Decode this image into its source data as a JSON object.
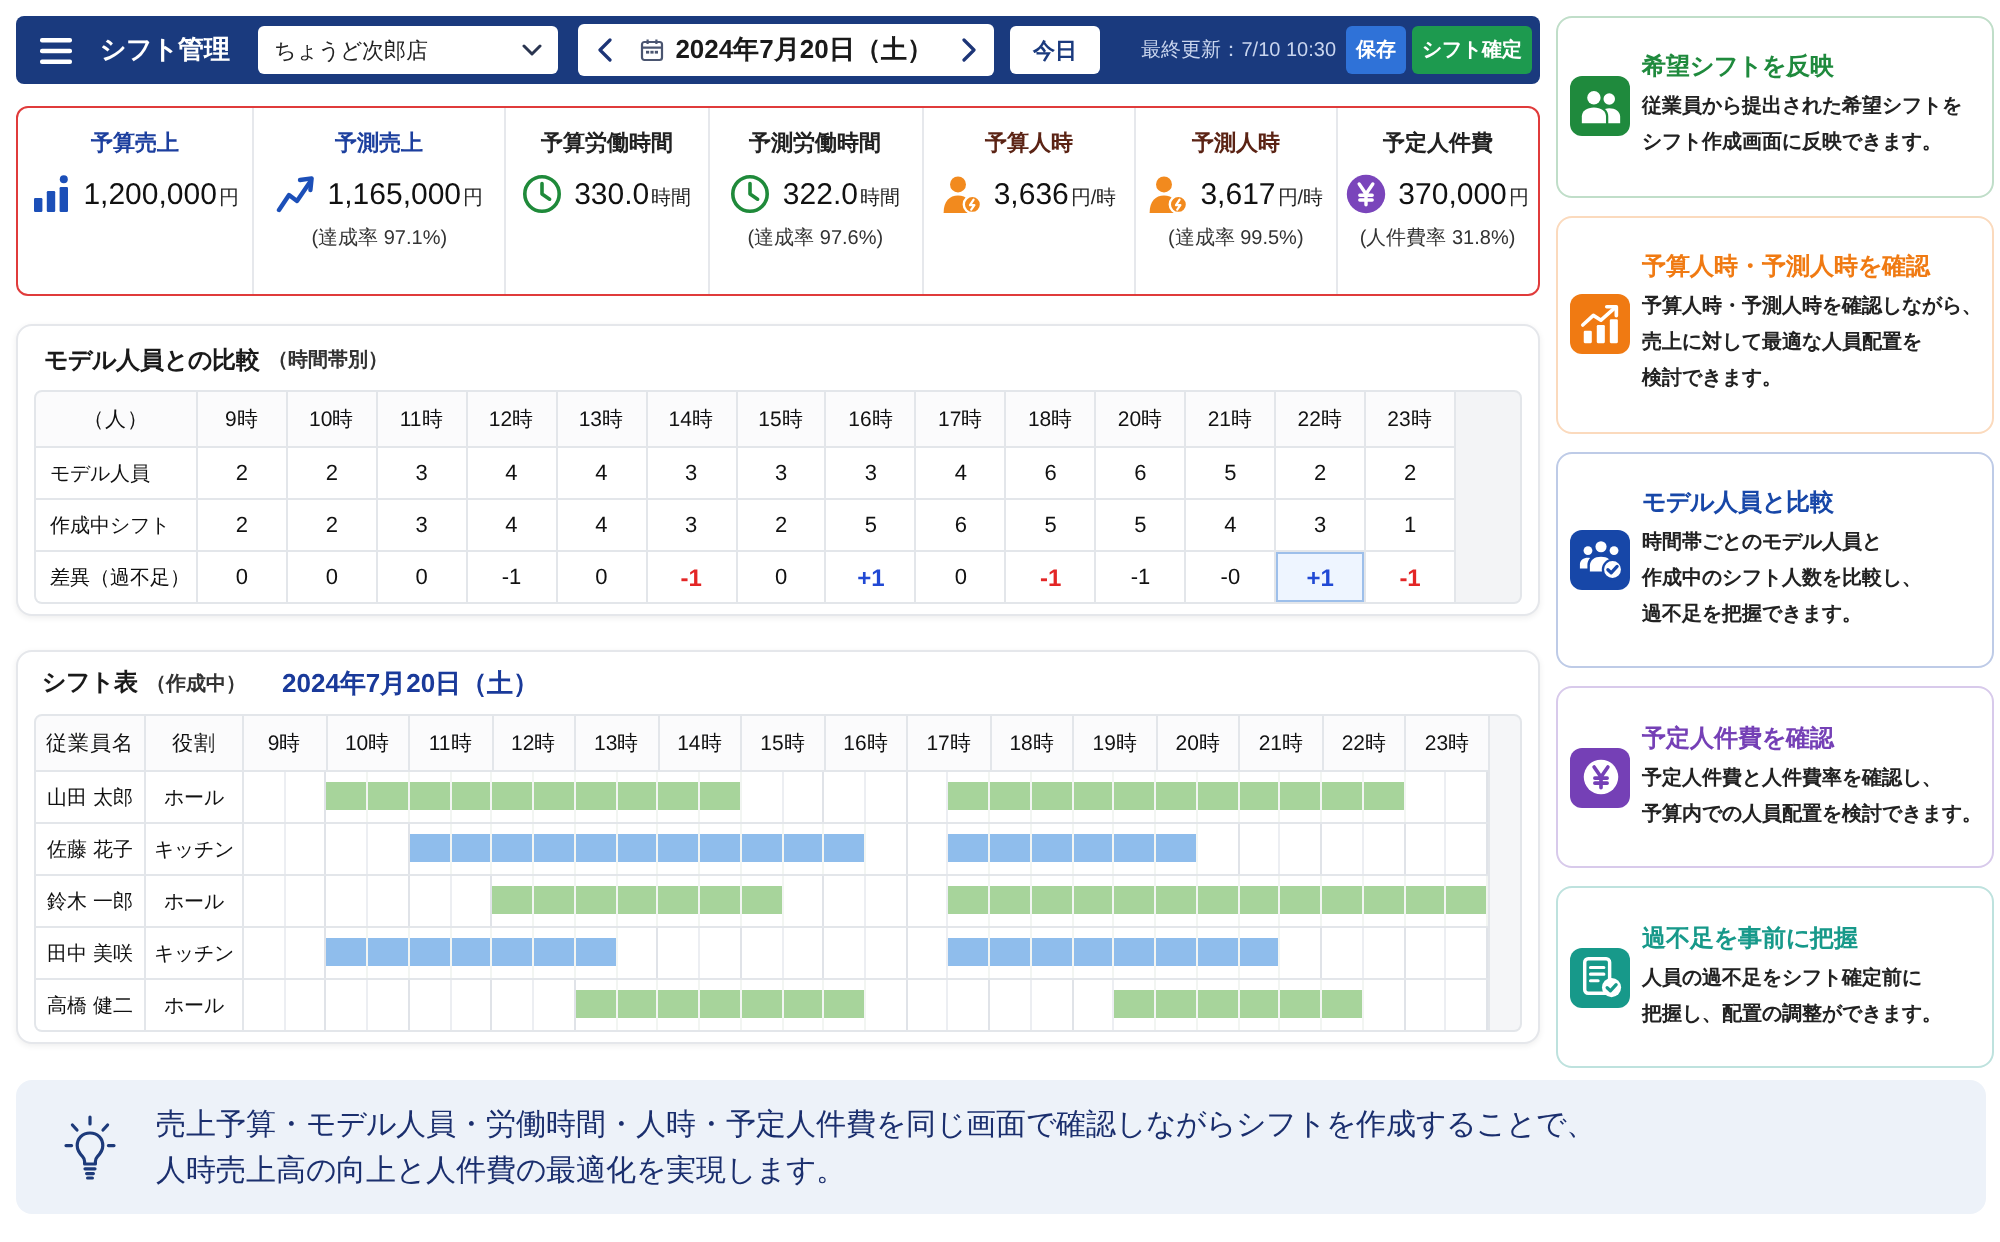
{
  "header": {
    "title": "シフト管理",
    "store_select": {
      "value": "ちょうど次郎店"
    },
    "date_nav": {
      "date": "2024年7月20日（土）"
    },
    "today_button": "今日",
    "last_updated": "最終更新：7/10 10:30",
    "buttons": [
      {
        "label": "保存",
        "kind": "save"
      },
      {
        "label": "シフト確定",
        "kind": "confirm"
      }
    ]
  },
  "kpis": [
    {
      "kind": "bar-chart",
      "label": "予算売上",
      "value": "1,200,000",
      "unit": "円"
    },
    {
      "kind": "trend",
      "label": "予測売上",
      "value": "1,165,000",
      "unit": "円",
      "note": "(達成率 97.1%)"
    },
    {
      "kind": "clock",
      "label": "予算労働時間",
      "value": "330.0",
      "unit": "時間"
    },
    {
      "kind": "clock",
      "label": "予測労働時間",
      "value": "322.0",
      "unit": "時間",
      "note": "(達成率 97.6%)"
    },
    {
      "kind": "person",
      "label": "予算人時",
      "value": "3,636",
      "unit": "円/時"
    },
    {
      "kind": "person",
      "label": "予測人時",
      "value": "3,617",
      "unit": "円/時",
      "note": "(達成率 99.5%)"
    },
    {
      "kind": "yen",
      "label": "予定人件費",
      "value": "370,000",
      "unit": "円",
      "note": "(人件費率 31.8%)"
    }
  ],
  "model_comparison": {
    "title": "モデル人員との比較",
    "subtitle": "（時間帯別）",
    "corner_label": "（人）",
    "hours": [
      "9時",
      "10時",
      "11時",
      "12時",
      "13時",
      "14時",
      "15時",
      "16時",
      "17時",
      "18時",
      "20時",
      "21時",
      "22時",
      "23時"
    ],
    "rows": [
      {
        "kind": "count",
        "label": "モデル人員",
        "values": [
          "2",
          "2",
          "3",
          "4",
          "4",
          "3",
          "3",
          "3",
          "4",
          "6",
          "6",
          "5",
          "2",
          "2"
        ]
      },
      {
        "kind": "count",
        "label": "作成中シフト",
        "values": [
          "2",
          "2",
          "3",
          "4",
          "4",
          "3",
          "2",
          "5",
          "6",
          "5",
          "5",
          "4",
          "3",
          "1"
        ]
      },
      {
        "kind": "diff",
        "label": "差異（過不足）",
        "cells": [
          {
            "text": "0",
            "shortage": false,
            "surplus": false,
            "highlighted": false
          },
          {
            "text": "0",
            "shortage": false,
            "surplus": false,
            "highlighted": false
          },
          {
            "text": "0",
            "shortage": false,
            "surplus": false,
            "highlighted": false
          },
          {
            "text": "-1",
            "shortage": false,
            "surplus": false,
            "highlighted": false
          },
          {
            "text": "0",
            "shortage": false,
            "surplus": false,
            "highlighted": false
          },
          {
            "text": "-1",
            "shortage": true,
            "surplus": false,
            "highlighted": false
          },
          {
            "text": "0",
            "shortage": false,
            "surplus": false,
            "highlighted": false
          },
          {
            "text": "+1",
            "shortage": false,
            "surplus": true,
            "highlighted": false
          },
          {
            "text": "0",
            "shortage": false,
            "surplus": false,
            "highlighted": false
          },
          {
            "text": "-1",
            "shortage": true,
            "surplus": false,
            "highlighted": false
          },
          {
            "text": "-1",
            "shortage": false,
            "surplus": false,
            "highlighted": false
          },
          {
            "text": "-0",
            "shortage": false,
            "surplus": false,
            "highlighted": false
          },
          {
            "text": "+1",
            "shortage": false,
            "surplus": true,
            "highlighted": true
          },
          {
            "text": "-1",
            "shortage": true,
            "surplus": false,
            "highlighted": false
          }
        ]
      }
    ]
  },
  "shift_table": {
    "title": "シフト表",
    "subtitle": "（作成中）",
    "date": "2024年7月20日（土）",
    "columns": [
      "従業員名",
      "役割"
    ],
    "hours": [
      "9時",
      "10時",
      "11時",
      "12時",
      "13時",
      "14時",
      "15時",
      "16時",
      "17時",
      "18時",
      "19時",
      "20時",
      "21時",
      "22時",
      "23時"
    ],
    "employees": [
      {
        "name": "山田 太郎",
        "role": "ホール",
        "color": "#a7d49b",
        "slots": [
          {
            "on": false
          },
          {
            "on": false
          },
          {
            "on": true
          },
          {
            "on": true
          },
          {
            "on": true
          },
          {
            "on": true
          },
          {
            "on": true
          },
          {
            "on": true
          },
          {
            "on": true
          },
          {
            "on": true
          },
          {
            "on": true
          },
          {
            "on": true
          },
          {
            "on": false
          },
          {
            "on": false
          },
          {
            "on": false
          },
          {
            "on": false
          },
          {
            "on": false
          },
          {
            "on": true
          },
          {
            "on": true
          },
          {
            "on": true
          },
          {
            "on": true
          },
          {
            "on": true
          },
          {
            "on": true
          },
          {
            "on": true
          },
          {
            "on": true
          },
          {
            "on": true
          },
          {
            "on": true
          },
          {
            "on": true
          },
          {
            "on": false
          },
          {
            "on": false
          }
        ]
      },
      {
        "name": "佐藤 花子",
        "role": "キッチン",
        "color": "#8fbdec",
        "slots": [
          {
            "on": false
          },
          {
            "on": false
          },
          {
            "on": false
          },
          {
            "on": false
          },
          {
            "on": true
          },
          {
            "on": true
          },
          {
            "on": true
          },
          {
            "on": true
          },
          {
            "on": true
          },
          {
            "on": true
          },
          {
            "on": true
          },
          {
            "on": true
          },
          {
            "on": true
          },
          {
            "on": true
          },
          {
            "on": true
          },
          {
            "on": false
          },
          {
            "on": false
          },
          {
            "on": true
          },
          {
            "on": true
          },
          {
            "on": true
          },
          {
            "on": true
          },
          {
            "on": true
          },
          {
            "on": true
          },
          {
            "on": false
          },
          {
            "on": false
          },
          {
            "on": false
          },
          {
            "on": false
          },
          {
            "on": false
          },
          {
            "on": false
          },
          {
            "on": false
          }
        ]
      },
      {
        "name": "鈴木 一郎",
        "role": "ホール",
        "color": "#a7d49b",
        "slots": [
          {
            "on": false
          },
          {
            "on": false
          },
          {
            "on": false
          },
          {
            "on": false
          },
          {
            "on": false
          },
          {
            "on": false
          },
          {
            "on": true
          },
          {
            "on": true
          },
          {
            "on": true
          },
          {
            "on": true
          },
          {
            "on": true
          },
          {
            "on": true
          },
          {
            "on": true
          },
          {
            "on": false
          },
          {
            "on": false
          },
          {
            "on": false
          },
          {
            "on": false
          },
          {
            "on": true
          },
          {
            "on": true
          },
          {
            "on": true
          },
          {
            "on": true
          },
          {
            "on": true
          },
          {
            "on": true
          },
          {
            "on": true
          },
          {
            "on": true
          },
          {
            "on": true
          },
          {
            "on": true
          },
          {
            "on": true
          },
          {
            "on": true
          },
          {
            "on": true
          }
        ]
      },
      {
        "name": "田中 美咲",
        "role": "キッチン",
        "color": "#8fbdec",
        "slots": [
          {
            "on": false
          },
          {
            "on": false
          },
          {
            "on": true
          },
          {
            "on": true
          },
          {
            "on": true
          },
          {
            "on": true
          },
          {
            "on": true
          },
          {
            "on": true
          },
          {
            "on": true
          },
          {
            "on": false
          },
          {
            "on": false
          },
          {
            "on": false
          },
          {
            "on": false
          },
          {
            "on": false
          },
          {
            "on": false
          },
          {
            "on": false
          },
          {
            "on": false
          },
          {
            "on": true
          },
          {
            "on": true
          },
          {
            "on": true
          },
          {
            "on": true
          },
          {
            "on": true
          },
          {
            "on": true
          },
          {
            "on": true
          },
          {
            "on": true
          },
          {
            "on": false
          },
          {
            "on": false
          },
          {
            "on": false
          },
          {
            "on": false
          },
          {
            "on": false
          }
        ]
      },
      {
        "name": "高橋 健二",
        "role": "ホール",
        "color": "#a7d49b",
        "slots": [
          {
            "on": false
          },
          {
            "on": false
          },
          {
            "on": false
          },
          {
            "on": false
          },
          {
            "on": false
          },
          {
            "on": false
          },
          {
            "on": false
          },
          {
            "on": false
          },
          {
            "on": true
          },
          {
            "on": true
          },
          {
            "on": true
          },
          {
            "on": true
          },
          {
            "on": true
          },
          {
            "on": true
          },
          {
            "on": true
          },
          {
            "on": false
          },
          {
            "on": false
          },
          {
            "on": false
          },
          {
            "on": false
          },
          {
            "on": false
          },
          {
            "on": false
          },
          {
            "on": true
          },
          {
            "on": true
          },
          {
            "on": true
          },
          {
            "on": true
          },
          {
            "on": true
          },
          {
            "on": true
          },
          {
            "on": false
          },
          {
            "on": false
          },
          {
            "on": false
          }
        ]
      }
    ]
  },
  "features": [
    {
      "kind": "people",
      "color": "#1f8a3d",
      "title": "希望シフトを反映",
      "lines": [
        "従業員から提出された希望シフトを",
        "シフト作成画面に反映できます。"
      ]
    },
    {
      "kind": "growth",
      "color": "#f07a12",
      "title": "予算人時・予測人時を確認",
      "lines": [
        "予算人時・予測人時を確認しながら、",
        "売上に対して最適な人員配置を",
        "検討できます。"
      ]
    },
    {
      "kind": "team",
      "color": "#1747a8",
      "title": "モデル人員と比較",
      "lines": [
        "時間帯ごとのモデル人員と",
        "作成中のシフト人数を比較し、",
        "過不足を把握できます。"
      ]
    },
    {
      "kind": "yen",
      "color": "#7540b6",
      "title": "予定人件費を確認",
      "lines": [
        "予定人件費と人件費率を確認し、",
        "予算内での人員配置を検討できます。"
      ]
    },
    {
      "kind": "checklist",
      "color": "#17998a",
      "title": "過不足を事前に把握",
      "lines": [
        "人員の過不足をシフト確定前に",
        "把握し、配置の調整ができます。"
      ]
    }
  ],
  "banner": {
    "lines": [
      "売上予算・モデル人員・労働時間・人時・予定人件費を同じ画面で確認しながらシフトを作成することで、",
      "人時売上高の向上と人件費の最適化を実現します。"
    ]
  }
}
